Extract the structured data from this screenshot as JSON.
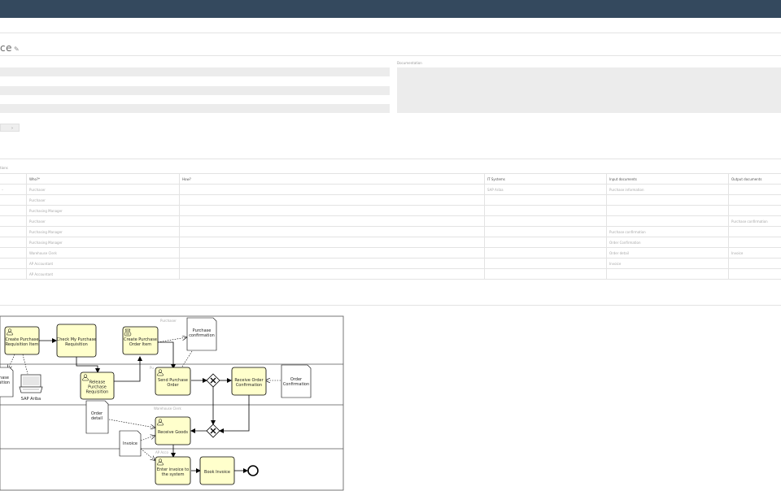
{
  "header": {
    "title_fragment": "ce"
  },
  "form": {
    "documentation_label": "Documentation",
    "expand_button": "›"
  },
  "table": {
    "caption": "tions",
    "headers": [
      "Who?*",
      "How?",
      "IT Systems",
      "Input documents",
      "Output documents"
    ],
    "rows": [
      {
        "lead": "–",
        "who": "Purchaser",
        "how": "",
        "it": "SAP Ariba",
        "input": "Purchase information",
        "output": ""
      },
      {
        "lead": "",
        "who": "Purchaser",
        "how": "",
        "it": "",
        "input": "",
        "output": ""
      },
      {
        "lead": "",
        "who": "Purchasing Manager",
        "how": "",
        "it": "",
        "input": "",
        "output": ""
      },
      {
        "lead": "",
        "who": "Purchaser",
        "how": "",
        "it": "",
        "input": "",
        "output": "Purchase confirmation"
      },
      {
        "lead": "",
        "who": "Purchasing Manager",
        "how": "",
        "it": "",
        "input": "Purchase confirmation",
        "output": ""
      },
      {
        "lead": "",
        "who": "Purchasing Manager",
        "how": "",
        "it": "",
        "input": "Order Confirmation",
        "output": ""
      },
      {
        "lead": "",
        "who": "Warehouse Clerk",
        "how": "",
        "it": "",
        "input": "Order detail",
        "output": "Invoice"
      },
      {
        "lead": "",
        "who": "AP Accountant",
        "how": "",
        "it": "",
        "input": "Invoice",
        "output": ""
      },
      {
        "lead": "",
        "who": "AP Accountant",
        "how": "",
        "it": "",
        "input": "",
        "output": ""
      }
    ]
  },
  "diagram": {
    "lanes": {
      "purchaser": "Purchaser",
      "purchasing_manager": "Pu",
      "warehouse_clerk": "Warehouse Clerk",
      "ap_accountant": "AP Acco"
    },
    "tasks": {
      "create_pr_item": "Create Purchase|Requisition Item",
      "check_pr": "Check My Purchase|Requisition",
      "release_pr": "Release|Purchase|Requisition",
      "create_po_item": "Create Purchase|Order Item",
      "send_po": "Send Purchase|Order",
      "receive_order_conf": "Receive Order|Confirmation",
      "receive_goods": "Receive Goods",
      "enter_invoice": "Enter invoice to|the system",
      "book_invoice": "Book Invoice"
    },
    "documents": {
      "purchase_req_left": "hase|uition",
      "purchase_confirmation": "Purchase|confirmation",
      "order_confirmation": "Order|Confirmation",
      "order_detail": "Order|detail",
      "invoice": "Invoice"
    },
    "systems": {
      "sap_ariba": "SAP Ariba"
    }
  }
}
